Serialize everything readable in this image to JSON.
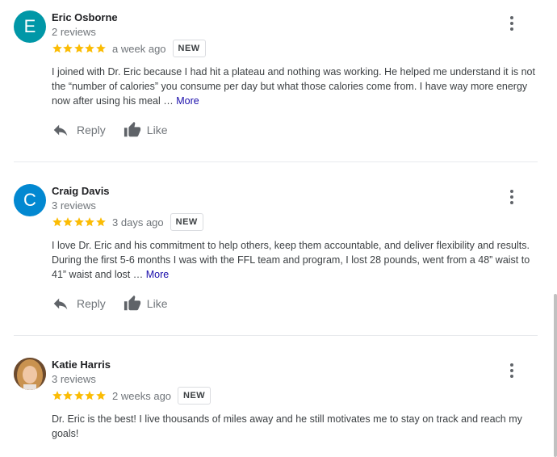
{
  "reviews": [
    {
      "initial": "E",
      "avatar_color": "#0097a7",
      "name": "Eric Osborne",
      "review_count": "2 reviews",
      "rating": 5,
      "when": "a week ago",
      "badge": "NEW",
      "text": "I joined with Dr. Eric because I had hit a plateau and nothing was working. He helped me understand it is not the “number of calories” you consume per day but what those calories come from. I have way more energy now after using his meal … ",
      "more": "More",
      "reply": "Reply",
      "like": "Like"
    },
    {
      "initial": "C",
      "avatar_color": "#0288d1",
      "name": "Craig Davis",
      "review_count": "3 reviews",
      "rating": 5,
      "when": "3 days ago",
      "badge": "NEW",
      "text": "I love Dr. Eric and his commitment to help others, keep them accountable, and deliver flexibility and results. During the first 5-6 months I was with the FFL team and program, I lost 28 pounds, went from a 48” waist to 41” waist and lost … ",
      "more": "More",
      "reply": "Reply",
      "like": "Like"
    },
    {
      "name": "Katie Harris",
      "review_count": "3 reviews",
      "rating": 5,
      "when": "2 weeks ago",
      "badge": "NEW",
      "text": "Dr. Eric is the best!  I live thousands of miles away and he still motivates me to stay on track and reach my goals!"
    }
  ],
  "colors": {
    "star": "#fbbc04",
    "more_link": "#1a0dab",
    "divider": "#e8eaed"
  },
  "icons": {
    "reply": "reply-arrow-icon",
    "like": "thumbs-up-icon",
    "menu": "more-vert-icon",
    "star": "star-icon"
  }
}
